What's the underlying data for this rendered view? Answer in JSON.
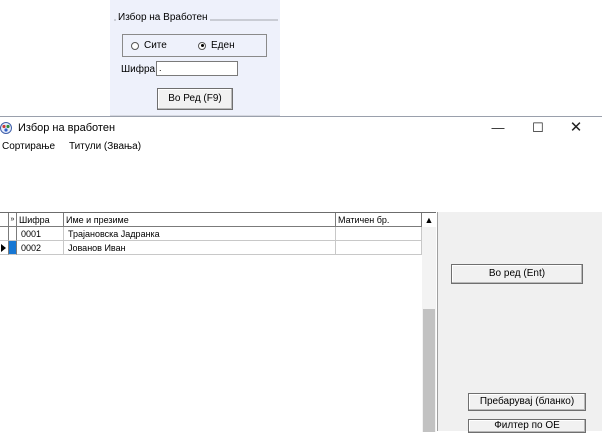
{
  "param_panel": {
    "group_title": "Избор на Вработен",
    "radio_all": "Сите",
    "radio_one": "Еден",
    "selected": "radio_one",
    "code_label": "Шифра:",
    "code_value": ".",
    "order_button": "Во Ред (F9)"
  },
  "window": {
    "title": "Избор на вработен",
    "minimize": "—",
    "maximize": "☐",
    "close": "✕",
    "menu": [
      "Сортирање",
      "Титули (Звања)"
    ]
  },
  "grid": {
    "columns": [
      "Шифра",
      "Име и презиме",
      "Матичен бр."
    ],
    "rows": [
      {
        "code": "0001",
        "name": "Трајановска Јадранка",
        "embg": ""
      },
      {
        "code": "0002",
        "name": "Јованов Иван",
        "embg": ""
      }
    ],
    "current_row": 1,
    "scroll_up": "▲"
  },
  "side": {
    "order_button": "Во ред (Ent)",
    "search_button": "Пребарувај (бланко)",
    "filter_button": "Филтер по ОЕ"
  },
  "colors": {
    "selected_cell": "#1677d4",
    "panel_background": "#eef1fb"
  }
}
